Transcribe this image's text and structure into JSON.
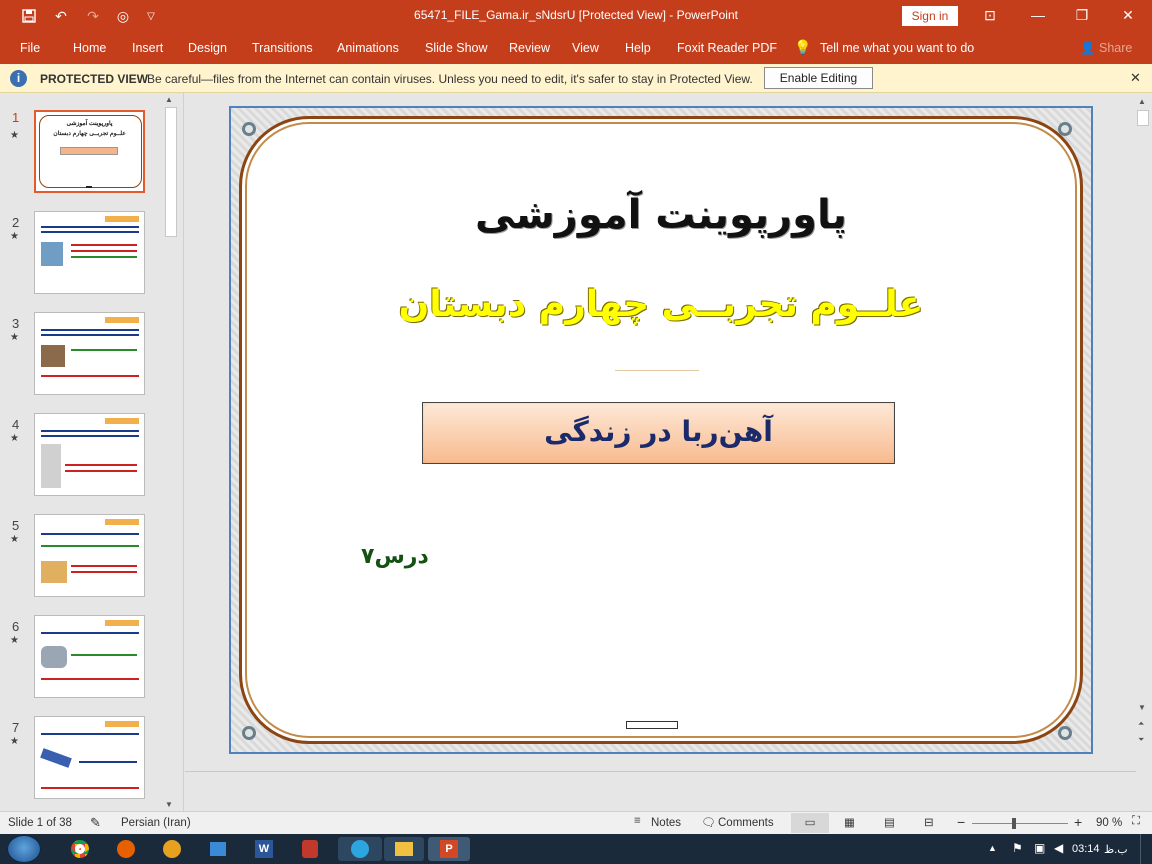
{
  "window": {
    "title": "65471_FILE_Gama.ir_sNdsrU [Protected View]  -  PowerPoint",
    "sign_in": "Sign in",
    "quick_access": [
      "save-icon",
      "undo-icon",
      "redo-icon",
      "presentation-icon",
      "customize-icon"
    ]
  },
  "ribbon": {
    "tabs": [
      "File",
      "Home",
      "Insert",
      "Design",
      "Transitions",
      "Animations",
      "Slide Show",
      "Review",
      "View",
      "Help",
      "Foxit Reader PDF"
    ],
    "tell_me": "Tell me what you want to do",
    "share": "Share"
  },
  "protected_view": {
    "label": "PROTECTED VIEW",
    "message": "Be careful—files from the Internet can contain viruses. Unless you need to edit, it's safer to stay in Protected View.",
    "enable_button": "Enable Editing"
  },
  "thumbnails": [
    {
      "number": "1",
      "star": "★"
    },
    {
      "number": "2",
      "star": "★"
    },
    {
      "number": "3",
      "star": "★"
    },
    {
      "number": "4",
      "star": "★"
    },
    {
      "number": "5",
      "star": "★"
    },
    {
      "number": "6",
      "star": "★"
    },
    {
      "number": "7",
      "star": "★"
    }
  ],
  "slide": {
    "title": "پاورپوینت آموزشی",
    "subtitle": "علــوم تجربــی چهارم دبستان",
    "topic": "آهن‌ربا در زندگی",
    "lesson": "درس۷"
  },
  "status": {
    "slide_counter": "Slide 1 of 38",
    "language": "Persian (Iran)",
    "notes": "Notes",
    "comments": "Comments",
    "zoom": "90 %"
  },
  "taskbar": {
    "time": "03:14",
    "ampm": "ب.ظ"
  },
  "colors": {
    "accent": "#c43e1c",
    "banner": "#fff4ce",
    "subtitle": "#ffff00",
    "topic_text": "#1a2a6a",
    "lesson_text": "#145214"
  }
}
